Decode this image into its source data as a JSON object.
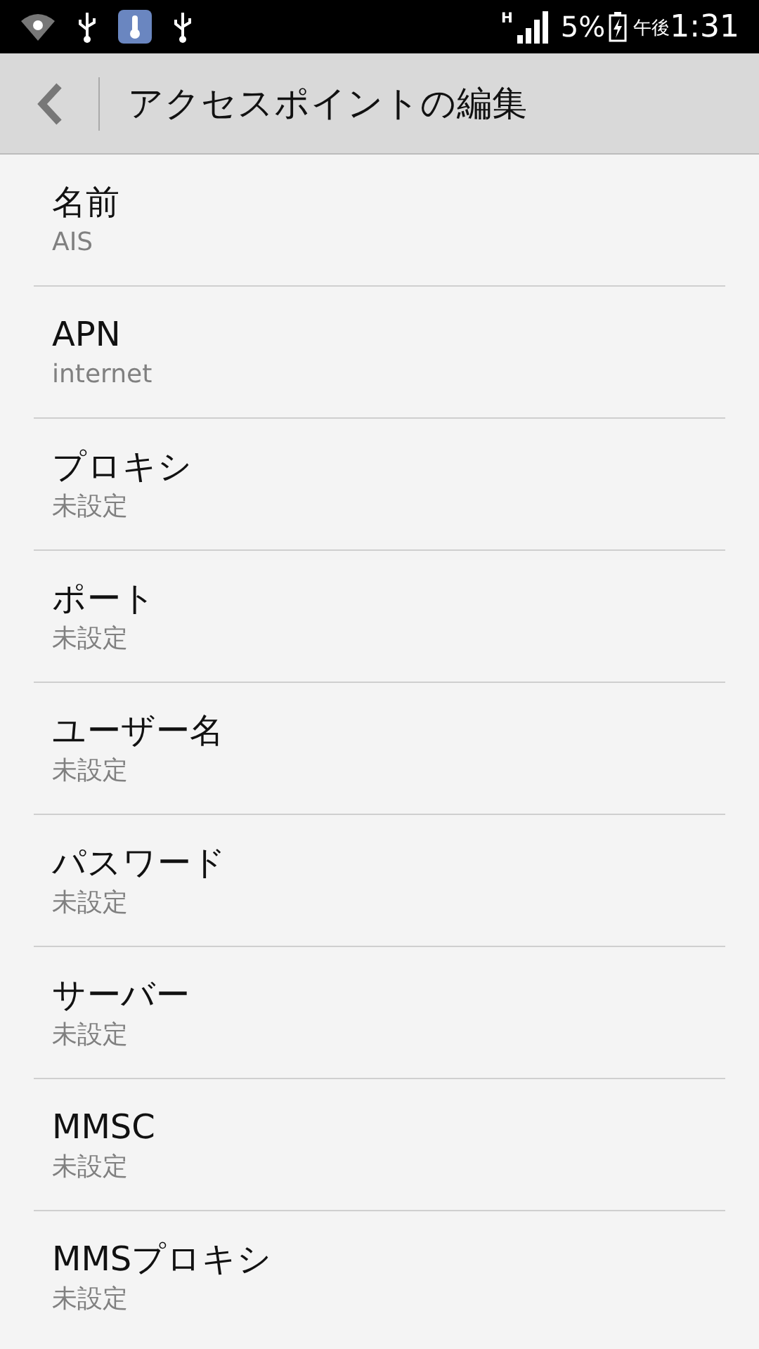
{
  "status_bar": {
    "network_type": "H",
    "battery": "5%",
    "ampm": "午後",
    "time": "1:31"
  },
  "header": {
    "title": "アクセスポイントの編集"
  },
  "settings": [
    {
      "label": "名前",
      "value": "AIS"
    },
    {
      "label": "APN",
      "value": "internet"
    },
    {
      "label": "プロキシ",
      "value": "未設定"
    },
    {
      "label": "ポート",
      "value": "未設定"
    },
    {
      "label": "ユーザー名",
      "value": "未設定"
    },
    {
      "label": "パスワード",
      "value": "未設定"
    },
    {
      "label": "サーバー",
      "value": "未設定"
    },
    {
      "label": "MMSC",
      "value": "未設定"
    },
    {
      "label": "MMSプロキシ",
      "value": "未設定"
    }
  ]
}
